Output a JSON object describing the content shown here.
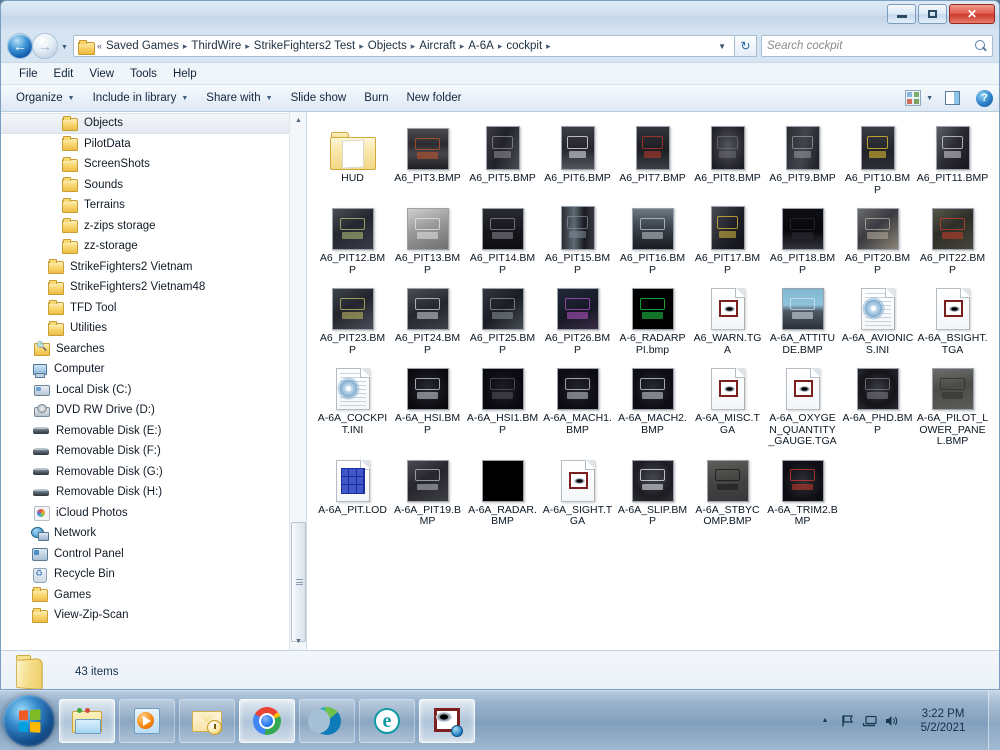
{
  "window": {
    "title": "",
    "controls": {
      "minimize": "–",
      "maximize": "□",
      "close": "✕"
    }
  },
  "nav": {
    "back_icon": "back-arrow-icon",
    "forward_icon": "forward-arrow-icon",
    "history_caret": "▼",
    "refresh_icon": "↻"
  },
  "breadcrumb": {
    "overflow": "«",
    "crumbs": [
      "Saved Games",
      "ThirdWire",
      "StrikeFighters2 Test",
      "Objects",
      "Aircraft",
      "A-6A",
      "cockpit"
    ],
    "separator": "▸",
    "dropdown_caret": "▼"
  },
  "search": {
    "placeholder": "Search cockpit",
    "value": ""
  },
  "menubar": {
    "items": [
      "File",
      "Edit",
      "View",
      "Tools",
      "Help"
    ]
  },
  "toolbar": {
    "items": [
      {
        "label": "Organize",
        "caret": "▼"
      },
      {
        "label": "Include in library",
        "caret": "▼"
      },
      {
        "label": "Share with",
        "caret": "▼"
      },
      {
        "label": "Slide show",
        "caret": ""
      },
      {
        "label": "Burn",
        "caret": ""
      },
      {
        "label": "New folder",
        "caret": ""
      }
    ],
    "view_caret": "▼",
    "help_label": "?"
  },
  "sidebar": {
    "items": [
      {
        "label": "Objects",
        "icon": "folder-icon",
        "indent": "ind1",
        "selected": true
      },
      {
        "label": "PilotData",
        "icon": "folder-icon",
        "indent": "ind1",
        "selected": false
      },
      {
        "label": "ScreenShots",
        "icon": "folder-icon",
        "indent": "ind1",
        "selected": false
      },
      {
        "label": "Sounds",
        "icon": "folder-icon",
        "indent": "ind1",
        "selected": false
      },
      {
        "label": "Terrains",
        "icon": "folder-icon",
        "indent": "ind1",
        "selected": false
      },
      {
        "label": "z-zips storage",
        "icon": "folder-icon",
        "indent": "ind1",
        "selected": false
      },
      {
        "label": "zz-storage",
        "icon": "folder-icon",
        "indent": "ind1",
        "selected": false
      },
      {
        "label": "StrikeFighters2 Vietnam",
        "icon": "folder-icon",
        "indent": "ind2",
        "selected": false
      },
      {
        "label": "StrikeFighters2 Vietnam48",
        "icon": "folder-icon",
        "indent": "ind2",
        "selected": false
      },
      {
        "label": "TFD Tool",
        "icon": "folder-icon",
        "indent": "ind2",
        "selected": false
      },
      {
        "label": "Utilities",
        "icon": "folder-icon",
        "indent": "ind2",
        "selected": false
      },
      {
        "label": "Searches",
        "icon": "saved-search-icon",
        "indent": "ind3",
        "selected": false
      },
      {
        "label": "Computer",
        "icon": "computer-icon",
        "indent": "ind4",
        "selected": false
      },
      {
        "label": "Local Disk (C:)",
        "icon": "hard-disk-icon",
        "indent": "ind3",
        "selected": false
      },
      {
        "label": "DVD RW Drive (D:)",
        "icon": "dvd-drive-icon",
        "indent": "ind3",
        "selected": false
      },
      {
        "label": "Removable Disk (E:)",
        "icon": "removable-disk-icon",
        "indent": "ind3",
        "selected": false
      },
      {
        "label": "Removable Disk (F:)",
        "icon": "removable-disk-icon",
        "indent": "ind3",
        "selected": false
      },
      {
        "label": "Removable Disk (G:)",
        "icon": "removable-disk-icon",
        "indent": "ind3",
        "selected": false
      },
      {
        "label": "Removable Disk (H:)",
        "icon": "removable-disk-icon",
        "indent": "ind3",
        "selected": false
      },
      {
        "label": "iCloud Photos",
        "icon": "icloud-photos-icon",
        "indent": "ind3",
        "selected": false
      },
      {
        "label": "Network",
        "icon": "network-icon",
        "indent": "ind4",
        "selected": false
      },
      {
        "label": "Control Panel",
        "icon": "control-panel-icon",
        "indent": "ind4",
        "selected": false
      },
      {
        "label": "Recycle Bin",
        "icon": "recycle-bin-icon",
        "indent": "ind4",
        "selected": false
      },
      {
        "label": "Games",
        "icon": "folder-icon",
        "indent": "ind4",
        "selected": false
      },
      {
        "label": "View-Zip-Scan",
        "icon": "folder-icon",
        "indent": "ind4",
        "selected": false
      }
    ],
    "scroll_up": "▲",
    "scroll_down": "▼"
  },
  "files": [
    {
      "name": "HUD",
      "kind": "folder"
    },
    {
      "name": "A6_PIT3.BMP",
      "kind": "thumb",
      "bg": "linear-gradient(180deg,#4b4b50 0%,#2b2b30 38%,#46464b 62%,#1d1d22 100%)",
      "accent": "#c6562a"
    },
    {
      "name": "A6_PIT5.BMP",
      "kind": "thumb-tall",
      "bg": "linear-gradient(110deg,#3a3a40 0%,#22222a 45%,#4a4a52 100%)",
      "accent": "#8f8f96"
    },
    {
      "name": "A6_PIT6.BMP",
      "kind": "thumb-tall",
      "bg": "linear-gradient(180deg,#3d3d44 0%,#24242b 50%,#55555e 100%)",
      "accent": "#e8e8ee"
    },
    {
      "name": "A6_PIT7.BMP",
      "kind": "thumb-tall",
      "bg": "linear-gradient(180deg,#34343b 0%,#1d1d24 55%,#3e3e46 100%)",
      "accent": "#bd3a28"
    },
    {
      "name": "A6_PIT8.BMP",
      "kind": "thumb-tall",
      "bg": "radial-gradient(ellipse at 50% 45%, #55555d 0%, #2a2a31 62%, #171720 100%)",
      "accent": "#6d6d77"
    },
    {
      "name": "A6_PIT9.BMP",
      "kind": "thumb-tall",
      "bg": "linear-gradient(100deg,#2c2c33 0%,#44444d 50%,#1e1e25 100%)",
      "accent": "#9b9ba4"
    },
    {
      "name": "A6_PIT10.BMP",
      "kind": "thumb-tall",
      "bg": "linear-gradient(180deg,#3a3a42 0%,#23232a 60%,#2f2f37 100%)",
      "accent": "#e8c72e"
    },
    {
      "name": "A6_PIT11.BMP",
      "kind": "thumb-tall",
      "bg": "linear-gradient(120deg,#5e5e68 0%,#2a2a31 50%,#17171d 100%)",
      "accent": "#d7d7de"
    },
    {
      "name": "A6_PIT12.BMP",
      "kind": "thumb",
      "bg": "linear-gradient(150deg,#4c4c55 0%,#262630 45%,#3c3c46 100%)",
      "accent": "#b6c77a"
    },
    {
      "name": "A6_PIT13.BMP",
      "kind": "thumb",
      "bg": "linear-gradient(160deg,#cfcfcf 0%,#9a9a9a 45%,#6f6f6f 100%)",
      "accent": "#e6e6e6"
    },
    {
      "name": "A6_PIT14.BMP",
      "kind": "thumb",
      "bg": "linear-gradient(180deg,#2a2a31 0%,#16161c 55%,#0e0e12 100%)",
      "accent": "#8a8a94"
    },
    {
      "name": "A6_PIT15.BMP",
      "kind": "thumb-tall",
      "bg": "linear-gradient(90deg,#2c2c34 0%,#5d6a74 38%,#1a1a20 70%,#3a3a42 100%)",
      "accent": "#7f8c97"
    },
    {
      "name": "A6_PIT16.BMP",
      "kind": "thumb",
      "bg": "linear-gradient(180deg,#6d7883 0%,#3b434b 45%,#1a1d22 100%)",
      "accent": "#c3ccd4"
    },
    {
      "name": "A6_PIT17.BMP",
      "kind": "thumb-tall",
      "bg": "linear-gradient(120deg,#4a4a52 0%,#20202a 55%,#121218 100%)",
      "accent": "#ddc03c"
    },
    {
      "name": "A6_PIT18.BMP",
      "kind": "thumb",
      "bg": "linear-gradient(180deg,#0f0f14 0%,#08080c 55%,#33333b 100%)",
      "accent": "#2b2b33"
    },
    {
      "name": "A6_PIT20.BMP",
      "kind": "thumb",
      "bg": "linear-gradient(140deg,#6a6a6f 0%,#3a3a40 45%,#8d8678 100%)",
      "accent": "#b8b0a0"
    },
    {
      "name": "A6_PIT22.BMP",
      "kind": "thumb",
      "bg": "linear-gradient(150deg,#57574c 0%,#2e2e28 45%,#46463c 100%)",
      "accent": "#c4402c"
    },
    {
      "name": "A6_PIT23.BMP",
      "kind": "thumb",
      "bg": "linear-gradient(150deg,#3f434b 0%,#22252c 45%,#4a4e57 100%)",
      "accent": "#c9c06a"
    },
    {
      "name": "A6_PIT24.BMP",
      "kind": "thumb",
      "bg": "linear-gradient(160deg,#4a4e55 0%,#24272d 50%,#3c4047 100%)",
      "accent": "#cfd4da"
    },
    {
      "name": "A6_PIT25.BMP",
      "kind": "thumb",
      "bg": "linear-gradient(140deg,#31353d 0%,#1a1d23 50%,#474c55 100%)",
      "accent": "#8d939c"
    },
    {
      "name": "A6_PIT26.BMP",
      "kind": "thumb",
      "bg": "linear-gradient(160deg,#24283a 0%,#151824 55%,#3a2c46 100%)",
      "accent": "#b455c9"
    },
    {
      "name": "A-6_RADARPPI.bmp",
      "kind": "thumb",
      "bg": "#000000",
      "accent": "#1fd44a"
    },
    {
      "name": "A6_WARN.TGA",
      "kind": "doc-eye"
    },
    {
      "name": "A-6A_ATTITUDE.BMP",
      "kind": "thumb",
      "bg": "linear-gradient(180deg,#7fb8d4 0%,#8fc3dc 40%,#4f5a64 55%,#2a2f36 100%)",
      "accent": "#d6e4ee"
    },
    {
      "name": "A-6A_AVIONICS.INI",
      "kind": "doc-ini"
    },
    {
      "name": "A-6A_BSIGHT.TGA",
      "kind": "doc-eye"
    },
    {
      "name": "A-6A_COCKPIT.INI",
      "kind": "doc-ini"
    },
    {
      "name": "A-6A_HSI.BMP",
      "kind": "thumb",
      "bg": "radial-gradient(circle at 50% 50%, #2b2b33 0%, #101016 60%, #05050a 100%)",
      "accent": "#cfd6de"
    },
    {
      "name": "A-6A_HSI1.BMP",
      "kind": "thumb",
      "bg": "radial-gradient(circle at 50% 50%, #1d1d24 0%, #0a0a10 70%)",
      "accent": "#55555e"
    },
    {
      "name": "A-6A_MACH1.BMP",
      "kind": "thumb",
      "bg": "radial-gradient(circle at 50% 50%, #25252c 0%, #0c0c12 70%)",
      "accent": "#c8cdd4"
    },
    {
      "name": "A-6A_MACH2.BMP",
      "kind": "thumb",
      "bg": "radial-gradient(circle at 50% 50%, #2a2a32 0%, #0d0d13 70%)",
      "accent": "#d2d7de"
    },
    {
      "name": "A-6A_MISC.TGA",
      "kind": "doc-eye"
    },
    {
      "name": "A-6A_OXYGEN_QUANTITY_GAUGE.TGA",
      "kind": "doc-eye"
    },
    {
      "name": "A-6A_PHD.BMP",
      "kind": "thumb",
      "bg": "radial-gradient(ellipse at 50% 48%, #3a3a42 0%, #141419 58%, #2a2a31 100%)",
      "accent": "#7d7d87"
    },
    {
      "name": "A-6A_PILOT_LOWER_PANEL.BMP",
      "kind": "thumb",
      "bg": "linear-gradient(170deg,#6e6e6a 0%,#4a4a48 45%,#5c5c58 100%)",
      "accent": "#2e2e2c"
    },
    {
      "name": "A-6A_PIT.LOD",
      "kind": "doc-lod"
    },
    {
      "name": "A-6A_PIT19.BMP",
      "kind": "thumb",
      "bg": "linear-gradient(150deg,#4a4a50 0%,#26262c 45%,#3e3e45 100%)",
      "accent": "#b9bfc6"
    },
    {
      "name": "A-6A_RADAR.BMP",
      "kind": "thumb",
      "bg": "#000000",
      "accent": "#000000"
    },
    {
      "name": "A-6A_SIGHT.TGA",
      "kind": "doc-eye"
    },
    {
      "name": "A-6A_SLIP.BMP",
      "kind": "thumb",
      "bg": "radial-gradient(circle at 50% 42%, #46464e 0%, #1c1c22 62%, #2c2c33 100%)",
      "accent": "#eef2f6"
    },
    {
      "name": "A-6A_STBYCOMP.BMP",
      "kind": "thumb",
      "bg": "linear-gradient(170deg,#5d5d5a 0%,#464644 45%,#37373a 100%)",
      "accent": "#16161a"
    },
    {
      "name": "A-6A_TRIM2.BMP",
      "kind": "thumb",
      "bg": "radial-gradient(circle at 50% 50%, #2e2e35 0%, #0e0e14 70%)",
      "accent": "#cf3c30"
    }
  ],
  "status": {
    "item_count": "43 items"
  },
  "taskbar": {
    "start_label": "start-orb",
    "buttons": [
      {
        "name": "taskbar-windows-explorer",
        "icon": "explorer",
        "active": true
      },
      {
        "name": "taskbar-windows-media-player",
        "icon": "wmp",
        "active": false
      },
      {
        "name": "taskbar-mail-client",
        "icon": "mail",
        "active": false
      },
      {
        "name": "taskbar-google-chrome",
        "icon": "chrome",
        "active": true
      },
      {
        "name": "taskbar-microsoft-edge",
        "icon": "edge",
        "active": false
      },
      {
        "name": "taskbar-internet-explorer-edge-legacy",
        "icon": "elegacy",
        "active": false
      },
      {
        "name": "taskbar-image-viewer",
        "icon": "viewer",
        "active": true
      }
    ],
    "tray": {
      "overflow_caret": "▲",
      "action_center_icon": "flag-icon",
      "network_icon": "network-tray-icon",
      "volume_icon": "🔊",
      "time": "3:22 PM",
      "date": "5/2/2021"
    }
  },
  "colors": {
    "accent": "#2b80c8",
    "frame": "#d6e3f0",
    "close_red": "#c93b2c",
    "folder_yellow": "#f8d873"
  }
}
